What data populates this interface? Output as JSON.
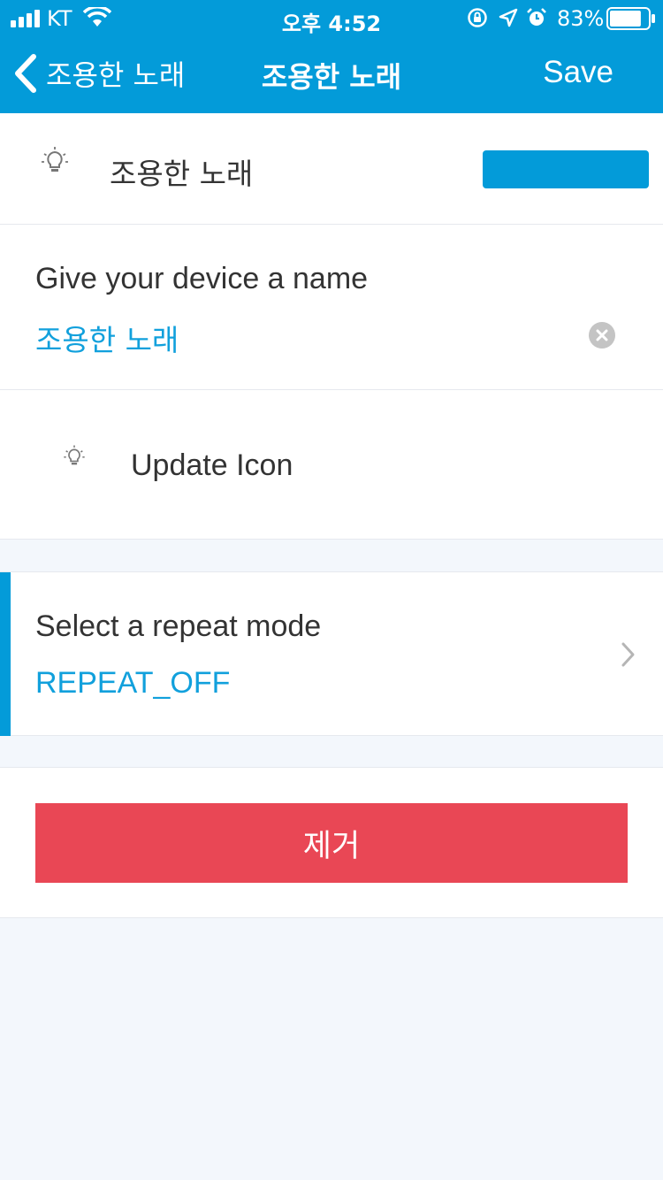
{
  "status_bar": {
    "carrier": "KT",
    "time": "오후 4:52",
    "battery_percent": "83%",
    "battery_level": 0.83
  },
  "nav": {
    "back_label": "조용한 노래",
    "title": "조용한 노래",
    "save_label": "Save"
  },
  "device_header": {
    "icon": "lightbulb-icon",
    "name": "조용한 노래",
    "color": "#039bd9"
  },
  "name_field": {
    "label": "Give your device a name",
    "value": "조용한 노래"
  },
  "icon_row": {
    "icon": "lightbulb-icon",
    "label": "Update Icon"
  },
  "repeat_mode": {
    "label": "Select a repeat mode",
    "value": "REPEAT_OFF"
  },
  "remove_button": {
    "label": "제거",
    "color": "#e94755"
  },
  "colors": {
    "accent": "#039bd9",
    "link": "#11a0dc",
    "background": "#f3f7fc"
  }
}
